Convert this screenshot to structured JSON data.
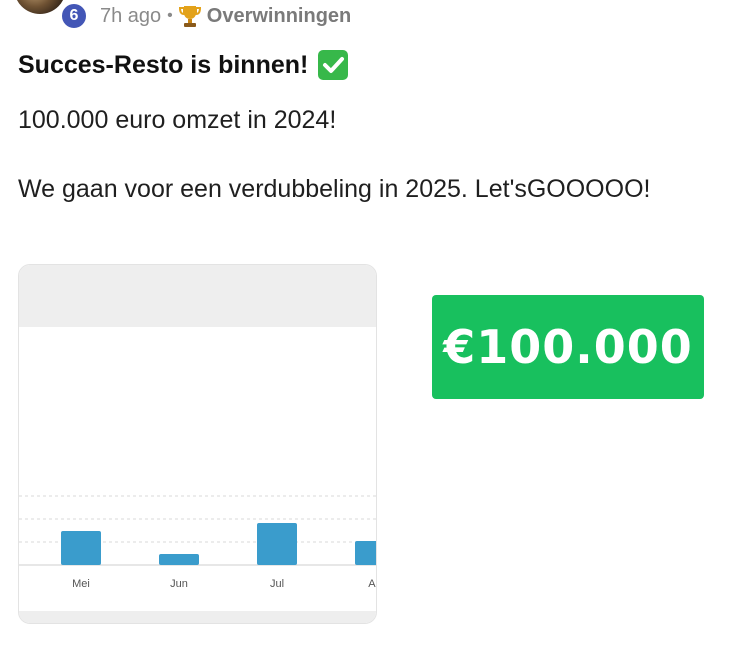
{
  "post": {
    "level": "6",
    "time_ago": "7h ago",
    "separator": "•",
    "category": "Overwinningen",
    "title": "Succes-Resto is binnen!",
    "line1": "100.000 euro omzet in 2024!",
    "line2": "We gaan voor een verdubbeling in 2025. Let'sGOOOOO!"
  },
  "badge": {
    "amount": "€100.000",
    "color": "#18c05e"
  },
  "icons": {
    "trophy": "trophy-icon",
    "check": "check-icon"
  },
  "chart_data": {
    "type": "bar",
    "categories": [
      "Mei",
      "Jun",
      "Jul",
      "Au"
    ],
    "values": [
      34,
      11,
      42,
      24
    ],
    "ylim": [
      0,
      100
    ],
    "grid": true,
    "bar_color": "#3a9ccc",
    "xlabel": "",
    "ylabel": "",
    "title": ""
  }
}
